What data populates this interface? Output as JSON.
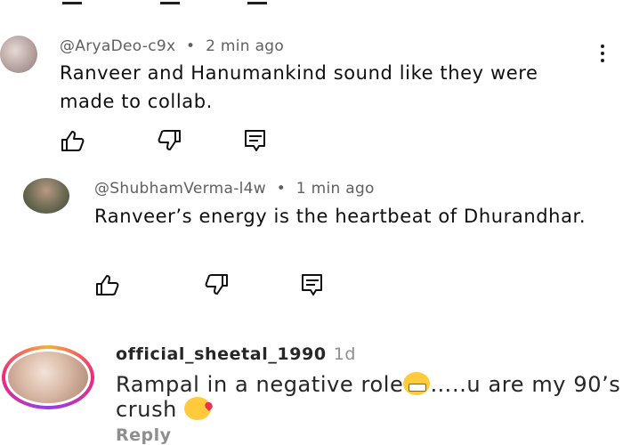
{
  "comment1": {
    "handle": "@AryaDeo-c9x",
    "separator": "•",
    "time": "2 min ago",
    "text": "Ranveer and Hanumankind sound like they were made to collab."
  },
  "comment2": {
    "handle": "@ShubhamVerma-l4w",
    "separator": "•",
    "time": "1 min ago",
    "text": "Ranveer’s energy is the heartbeat of Dhurandhar."
  },
  "instagram_comment": {
    "username": "official_sheetal_1990",
    "age": "1d",
    "text_part1": "Rampal in a negative role",
    "text_part2": "…..u are my 90’s crush",
    "reply_label": "Reply"
  },
  "icons": [
    "like-icon",
    "dislike-icon",
    "reply-icon",
    "more-options-icon",
    "grimacing-face-emoji",
    "face-blowing-kiss-emoji"
  ],
  "colors": {
    "text": "#0f0f0f",
    "meta": "#606060",
    "ig_text": "#262626",
    "ig_muted": "#8e8e8e"
  }
}
